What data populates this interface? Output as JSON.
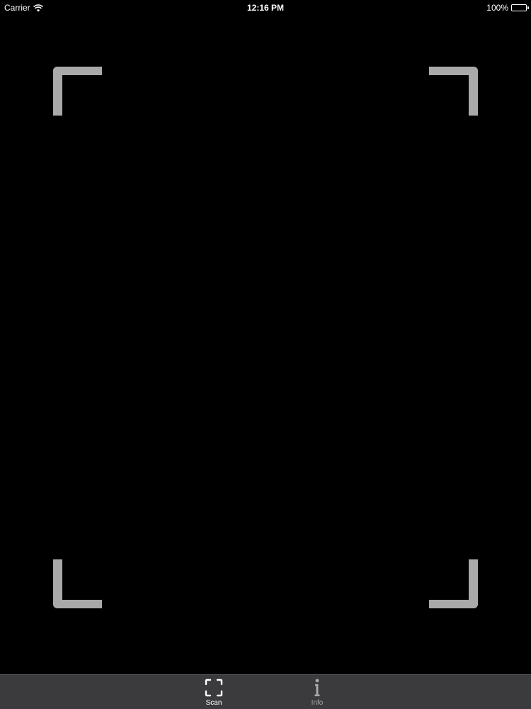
{
  "status_bar": {
    "carrier": "Carrier",
    "time": "12:16 PM",
    "battery": "100%",
    "battery_level": 1.0
  },
  "scan_frame": {
    "corner_color": "#a9a9a9"
  },
  "tab_bar": {
    "background": "#3b3b3d",
    "items": [
      {
        "label": "Scan",
        "icon": "scan-icon",
        "selected": true
      },
      {
        "label": "Info",
        "icon": "info-icon",
        "selected": false
      }
    ]
  }
}
